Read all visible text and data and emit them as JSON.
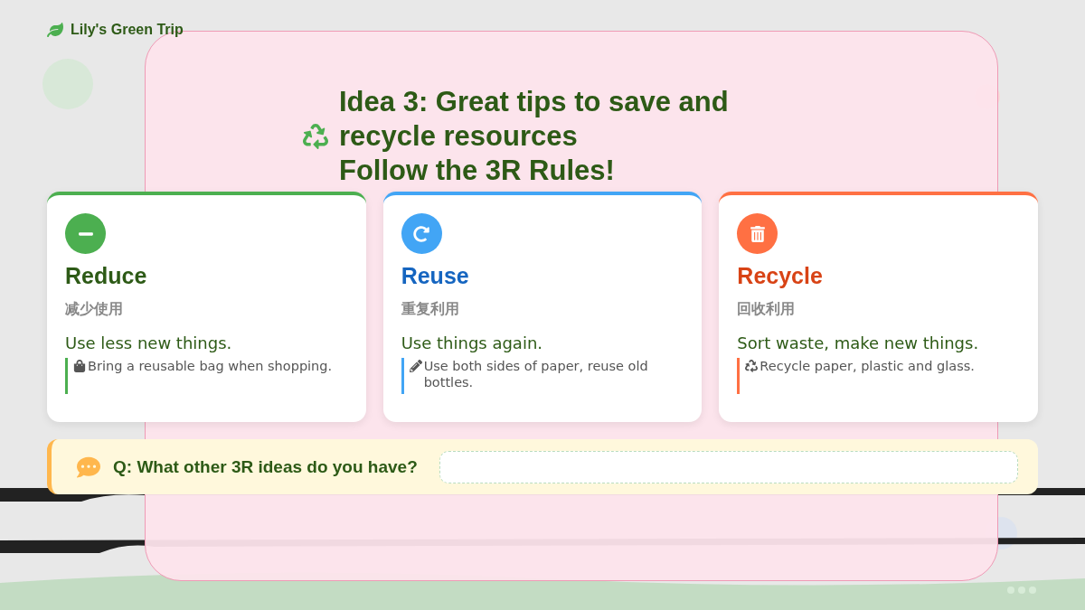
{
  "brand": {
    "name": "Lily's Green Trip"
  },
  "heading": {
    "title": "Idea 3: Great tips to save and recycle resources",
    "subtitle": "Follow the 3R Rules!"
  },
  "cards": [
    {
      "kind": "reduce",
      "title": "Reduce",
      "chinese": "减少使用",
      "summary": "Use less new things.",
      "tip": "Bring a reusable bag when shopping."
    },
    {
      "kind": "reuse",
      "title": "Reuse",
      "chinese": "重复利用",
      "summary": "Use things again.",
      "tip": "Use both sides of paper, reuse old bottles."
    },
    {
      "kind": "recycle",
      "title": "Recycle",
      "chinese": "回收利用",
      "summary": "Sort waste, make new things.",
      "tip": "Recycle paper, plastic and glass."
    }
  ],
  "question": {
    "text": "Q: What other 3R ideas do you have?"
  }
}
